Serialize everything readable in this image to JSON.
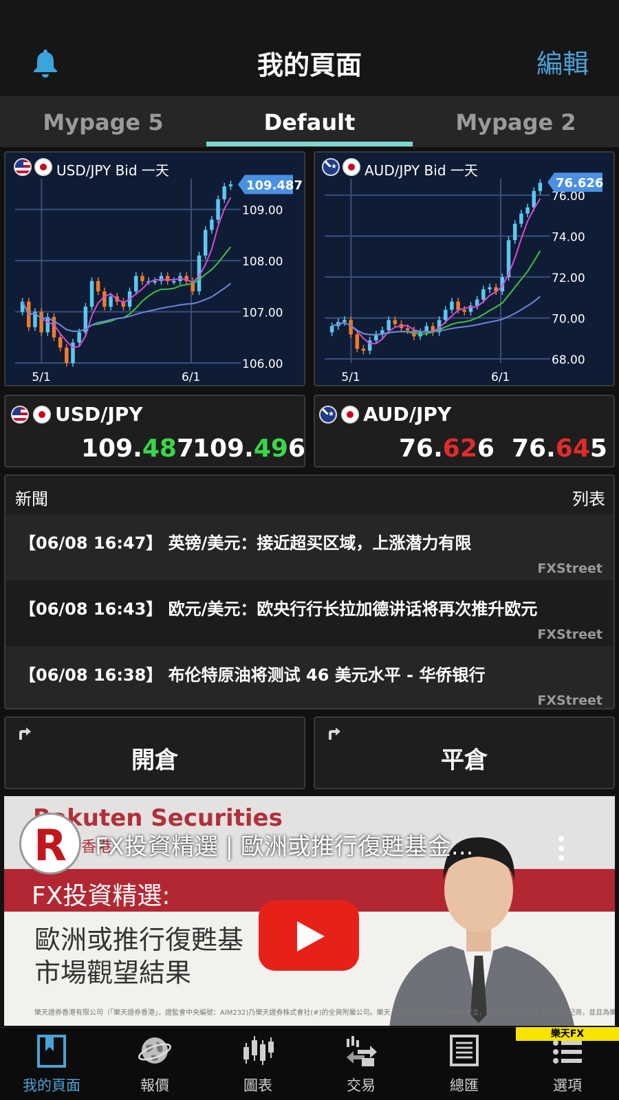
{
  "header": {
    "title": "我的頁面",
    "edit_label": "編輯"
  },
  "tabs": [
    {
      "label": "Mypage 5"
    },
    {
      "label": "Default"
    },
    {
      "label": "Mypage 2"
    }
  ],
  "active_tab": "Default",
  "charts": [
    {
      "title": "USD/JPY Bid 一天",
      "last_price_label": "109.487",
      "y_ticks": [
        "109.00",
        "108.00",
        "107.00",
        "106.00"
      ],
      "x_ticks": [
        "5/1",
        "6/1"
      ]
    },
    {
      "title": "AUD/JPY Bid 一天",
      "last_price_label": "76.626",
      "y_ticks": [
        "76.00",
        "74.00",
        "72.00",
        "70.00",
        "68.00"
      ],
      "x_ticks": [
        "5/1",
        "6/1"
      ]
    }
  ],
  "chart_data": [
    {
      "type": "candlestick",
      "title": "USD/JPY Bid 一天",
      "x_ticks": [
        "5/1",
        "6/1"
      ],
      "ylim": [
        106.0,
        109.6
      ],
      "last_price": 109.487,
      "closes": [
        107.2,
        106.7,
        107.0,
        106.6,
        106.9,
        106.5,
        106.3,
        106.0,
        106.4,
        106.6,
        107.1,
        107.6,
        107.4,
        107.1,
        107.3,
        107.2,
        107.1,
        107.4,
        107.7,
        107.6,
        107.6,
        107.6,
        107.7,
        107.6,
        107.6,
        107.7,
        107.6,
        107.4,
        108.1,
        108.6,
        108.8,
        109.2,
        109.45,
        109.49
      ]
    },
    {
      "type": "candlestick",
      "title": "AUD/JPY Bid 一天",
      "x_ticks": [
        "5/1",
        "6/1"
      ],
      "ylim": [
        67.8,
        76.8
      ],
      "last_price": 76.626,
      "closes": [
        69.6,
        69.8,
        69.9,
        69.2,
        68.5,
        68.4,
        68.9,
        69.2,
        69.4,
        69.9,
        69.7,
        69.5,
        69.4,
        69.1,
        69.3,
        69.6,
        69.3,
        69.9,
        70.4,
        70.8,
        70.4,
        70.3,
        70.6,
        70.9,
        71.4,
        71.5,
        71.3,
        72.0,
        73.8,
        74.6,
        75.1,
        75.4,
        76.2,
        76.6
      ]
    }
  ],
  "quotes": [
    {
      "pair": "USD/JPY",
      "bid": {
        "pre": "109.",
        "hl": "48",
        "post": "7"
      },
      "ask": {
        "pre": "109.",
        "hl": "49",
        "post": "6"
      },
      "highlight_color": "#39d64a"
    },
    {
      "pair": "AUD/JPY",
      "bid": {
        "pre": "76.",
        "hl": "62",
        "post": "6"
      },
      "ask": {
        "pre": "76.",
        "hl": "64",
        "post": "5"
      },
      "highlight_color": "#e02b2b"
    }
  ],
  "news": {
    "title": "新聞",
    "list_label": "列表",
    "items": [
      {
        "text": "【06/08 16:47】 英镑/美元：接近超买区域，上涨潜力有限",
        "source": "FXStreet"
      },
      {
        "text": "【06/08 16:43】 欧元/美元：欧央行行长拉加德讲话将再次推升欧元",
        "source": "FXStreet"
      },
      {
        "text": "【06/08 16:38】 布伦特原油将测试 46 美元水平 - 华侨银行",
        "source": "FXStreet"
      }
    ]
  },
  "trade_buttons": {
    "open_label": "開倉",
    "close_label": "平倉"
  },
  "video": {
    "brand": "Rakuten Securities",
    "brand_sub": "券香港",
    "logo_letter": "R",
    "title": "FX投資精選 | 歐洲或推行復甦基金...",
    "banner": "FX投資精選:",
    "line1": "歐洲或推行復甦基",
    "line2": "市場觀望結果",
    "footnote": "樂天證券香港有限公司（「樂天證券香港」，證監會中央編號：AIM232)乃樂天證券株式會社(#)的全資附屬公司。樂天 證券株式會社於1999年成立，為日本其中一家主要網上經紀商，並且為樂天株式會社(TOKYO:4755)的附屬公司，植根"
  },
  "bottom_nav": {
    "items": [
      {
        "label": "我的頁面",
        "icon": "bookmark-icon"
      },
      {
        "label": "報價",
        "icon": "globe-icon"
      },
      {
        "label": "圖表",
        "icon": "candlestick-icon"
      },
      {
        "label": "交易",
        "icon": "trade-icon"
      },
      {
        "label": "總匯",
        "icon": "document-icon"
      },
      {
        "label": "選項",
        "icon": "menu-icon"
      }
    ],
    "badge": "樂天FX"
  },
  "colors": {
    "accent": "#4aa3d8",
    "tab_underline": "#7fd6d2",
    "chart_bg": "#0e1c36",
    "up_candle": "#5bc8f0",
    "down_candle": "#f07a2a",
    "ma_short": "#d94bd3",
    "ma_mid": "#3ec43e",
    "ma_long": "#6f86d8"
  }
}
